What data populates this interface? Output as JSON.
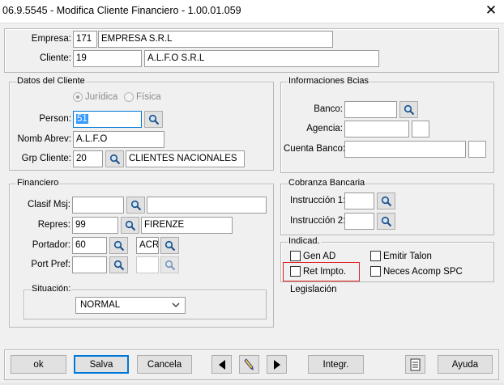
{
  "window": {
    "title": "06.9.5545 - Modifica Cliente Financiero - 1.00.01.059",
    "close_glyph": "✕"
  },
  "header": {
    "empresa": {
      "label": "Empresa:",
      "code": "171",
      "name": "EMPRESA  S.R.L"
    },
    "cliente": {
      "label": "Cliente:",
      "code": "19",
      "name": "A.L.F.O S.R.L"
    }
  },
  "datos_cliente": {
    "title": "Datos del Cliente",
    "radio_juridica": "Jurídica",
    "radio_fisica": "Física",
    "person": {
      "label": "Person:",
      "value": "51"
    },
    "nomb_abrev": {
      "label": "Nomb Abrev:",
      "value": "A.L.F.O"
    },
    "grp_cliente": {
      "label": "Grp Cliente:",
      "code": "20",
      "name": "CLIENTES NACIONALES"
    }
  },
  "informaciones_bcias": {
    "title": "Informaciones Bcias",
    "banco": {
      "label": "Banco:",
      "value": ""
    },
    "agencia": {
      "label": "Agencia:",
      "value": "",
      "extra": ""
    },
    "cuenta_banco": {
      "label": "Cuenta Banco:",
      "value": "",
      "extra": ""
    }
  },
  "financiero": {
    "title": "Financiero",
    "clasif_msj": {
      "label": "Clasif Msj:",
      "code": "",
      "name": ""
    },
    "repres": {
      "label": "Repres:",
      "code": "99",
      "name": "FIRENZE"
    },
    "portador": {
      "label": "Portador:",
      "code": "60",
      "name": "ACR"
    },
    "port_pref": {
      "label": "Port Pref:",
      "code": "",
      "name": ""
    },
    "situacion": {
      "title": "Situación:",
      "selected": "NORMAL"
    }
  },
  "cobranza_bancaria": {
    "title": "Cobranza Bancaria",
    "instruccion1": {
      "label": "Instrucción 1:",
      "value": ""
    },
    "instruccion2": {
      "label": "Instrucción 2:",
      "value": ""
    }
  },
  "indicad": {
    "title": "Indicad.",
    "gen_ad": "Gen AD",
    "emitir_talon": "Emitir Talon",
    "ret_impto": "Ret Impto.",
    "neces_acomp_spc": "Neces Acomp SPC",
    "legislacion": "Legislación"
  },
  "buttons": {
    "ok": "ok",
    "salva": "Salva",
    "cancela": "Cancela",
    "integr": "Integr.",
    "ayuda": "Ayuda"
  },
  "icons": {
    "search": "magnifier-icon",
    "prev": "triangle-left-icon",
    "next": "triangle-right-icon",
    "edit": "pen-icon",
    "doc": "document-icon"
  },
  "colors": {
    "highlight": "#3399ff",
    "default_button_border": "#0078d7",
    "red_annotation": "#e02020"
  }
}
